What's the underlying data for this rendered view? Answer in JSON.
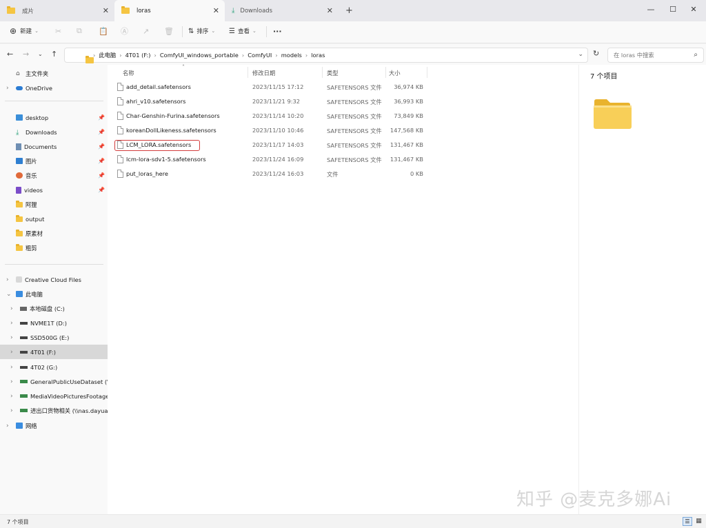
{
  "tabs": [
    {
      "label": "成片",
      "active": false
    },
    {
      "label": "loras",
      "active": true
    },
    {
      "label": "Downloads",
      "active": false
    }
  ],
  "new_tab_symbol": "+",
  "window_buttons": {
    "minimize": "—",
    "maximize": "☐",
    "close": "✕"
  },
  "toolbar": {
    "new_label": "新建",
    "sort_label": "排序",
    "view_label": "查看",
    "more_label": "···"
  },
  "breadcrumbs": [
    "此电脑",
    "4T01 (F:)",
    "ComfyUI_windows_portable",
    "ComfyUI",
    "models",
    "loras"
  ],
  "search": {
    "placeholder": "在 loras 中搜索"
  },
  "sidebar": {
    "top": [
      {
        "label": "主文件夹",
        "icon": "home-icon"
      },
      {
        "label": "OneDrive",
        "icon": "cloud-icon"
      }
    ],
    "quick": [
      {
        "label": "desktop",
        "icon": "desktop-icon"
      },
      {
        "label": "Downloads",
        "icon": "download-icon"
      },
      {
        "label": "Documents",
        "icon": "documents-icon"
      },
      {
        "label": "图片",
        "icon": "pictures-icon"
      },
      {
        "label": "音乐",
        "icon": "music-icon"
      },
      {
        "label": "videos",
        "icon": "videos-icon"
      },
      {
        "label": "阿狸",
        "icon": "folder-icon"
      },
      {
        "label": "output",
        "icon": "folder-icon"
      },
      {
        "label": "原素材",
        "icon": "folder-icon"
      },
      {
        "label": "粗剪",
        "icon": "folder-icon"
      }
    ],
    "tree": [
      {
        "label": "Creative Cloud Files",
        "icon": "cc-icon"
      },
      {
        "label": "此电脑",
        "icon": "pc-icon"
      },
      {
        "label": "本地磁盘 (C:)",
        "icon": "drive-icon"
      },
      {
        "label": "NVME1T (D:)",
        "icon": "drive-icon"
      },
      {
        "label": "SSD500G (E:)",
        "icon": "drive-icon"
      },
      {
        "label": "4T01 (F:)",
        "icon": "drive-icon"
      },
      {
        "label": "4T02 (G:)",
        "icon": "drive-icon"
      },
      {
        "label": "GeneralPublicUseDataset (\\\\na",
        "icon": "netdrive-icon"
      },
      {
        "label": "MediaVideoPicturesFootages",
        "icon": "netdrive-icon"
      },
      {
        "label": "进出口货物相关 (\\\\nas.dayuana",
        "icon": "netdrive-icon"
      },
      {
        "label": "网络",
        "icon": "network-icon"
      }
    ]
  },
  "columns": {
    "name": "名称",
    "date": "修改日期",
    "type": "类型",
    "size": "大小"
  },
  "files": [
    {
      "name": "add_detail.safetensors",
      "date": "2023/11/15 17:12",
      "type": "SAFETENSORS 文件",
      "size": "36,974 KB"
    },
    {
      "name": "ahri_v10.safetensors",
      "date": "2023/11/21 9:32",
      "type": "SAFETENSORS 文件",
      "size": "36,993 KB"
    },
    {
      "name": "Char-Genshin-Furina.safetensors",
      "date": "2023/11/14 10:20",
      "type": "SAFETENSORS 文件",
      "size": "73,849 KB"
    },
    {
      "name": "koreanDollLikeness.safetensors",
      "date": "2023/11/10 10:46",
      "type": "SAFETENSORS 文件",
      "size": "147,568 KB"
    },
    {
      "name": "LCM_LORA.safetensors",
      "date": "2023/11/17 14:03",
      "type": "SAFETENSORS 文件",
      "size": "131,467 KB"
    },
    {
      "name": "lcm-lora-sdv1-5.safetensors",
      "date": "2023/11/24 16:09",
      "type": "SAFETENSORS 文件",
      "size": "131,467 KB"
    },
    {
      "name": "put_loras_here",
      "date": "2023/11/24 16:03",
      "type": "文件",
      "size": "0 KB"
    }
  ],
  "details": {
    "count_label": "7 个项目"
  },
  "status": {
    "count_label": "7 个项目"
  },
  "watermark": "知乎 @麦克多娜Ai",
  "colors": {
    "highlight": "#d23c3c",
    "folder": "#f5c542",
    "selected_nav": "#d8d8d8"
  }
}
